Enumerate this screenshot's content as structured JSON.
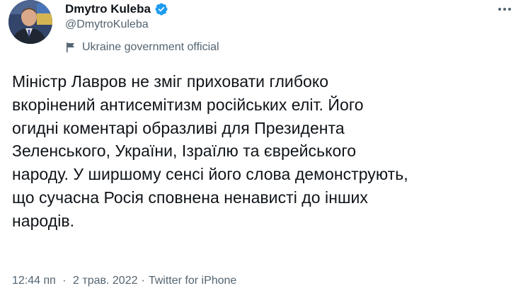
{
  "author": {
    "display_name": "Dmytro Kuleba",
    "handle": "@DmytroKuleba",
    "verified": true,
    "label": "Ukraine government official"
  },
  "tweet": {
    "text": "Міністр Лавров не зміг приховати глибоко\nвкорінений антисемітизм російських еліт. Його\nогидні коментарі образливі для Президента\nЗеленського, України, Ізраїлю та єврейського\nнароду. У ширшому сенсі його слова демонструють,\nщо сучасна Росія сповнена ненависті до інших\nнародів.",
    "time": "12:44 пп",
    "date": "2 трав. 2022",
    "separator": "·",
    "source": "Twitter for iPhone"
  },
  "icons": {
    "verified": "verified-badge-icon",
    "label": "flag-icon",
    "more": "more-horizontal-icon"
  },
  "colors": {
    "primary_text": "#0f1419",
    "secondary_text": "#536471",
    "verified_blue": "#1d9bf0",
    "background": "#ffffff"
  }
}
